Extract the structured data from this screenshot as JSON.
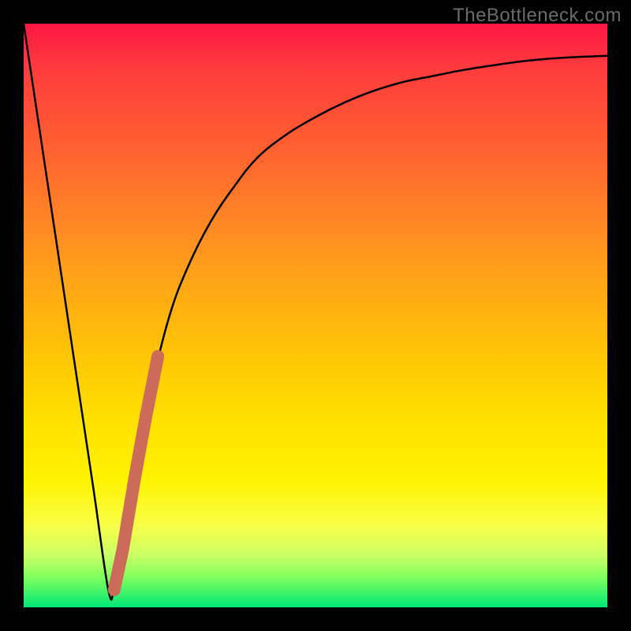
{
  "watermark": "TheBottleneck.com",
  "colors": {
    "frame": "#000000",
    "curve": "#000000",
    "highlight": "#cc6b5a",
    "gradient_top": "#ff1744",
    "gradient_bottom": "#00e676"
  },
  "chart_data": {
    "type": "line",
    "title": "",
    "xlabel": "",
    "ylabel": "",
    "xlim": [
      0,
      100
    ],
    "ylim": [
      0,
      100
    ],
    "grid": false,
    "series": [
      {
        "name": "bottleneck-curve",
        "x": [
          0,
          3,
          6,
          9,
          12,
          14.5,
          15.5,
          17,
          19,
          22,
          25,
          28,
          32,
          36,
          40,
          45,
          50,
          55,
          60,
          65,
          70,
          75,
          80,
          85,
          90,
          95,
          100
        ],
        "values": [
          100,
          80,
          60,
          40,
          20,
          3,
          3,
          10,
          22,
          38,
          50,
          58,
          66,
          72,
          77,
          81,
          84,
          86.5,
          88.5,
          90,
          91,
          92,
          92.8,
          93.5,
          94,
          94.3,
          94.5
        ]
      },
      {
        "name": "highlight-segment",
        "x": [
          15.5,
          17,
          19,
          21,
          23
        ],
        "values": [
          3,
          10,
          22,
          33,
          43
        ]
      }
    ],
    "annotations": []
  }
}
